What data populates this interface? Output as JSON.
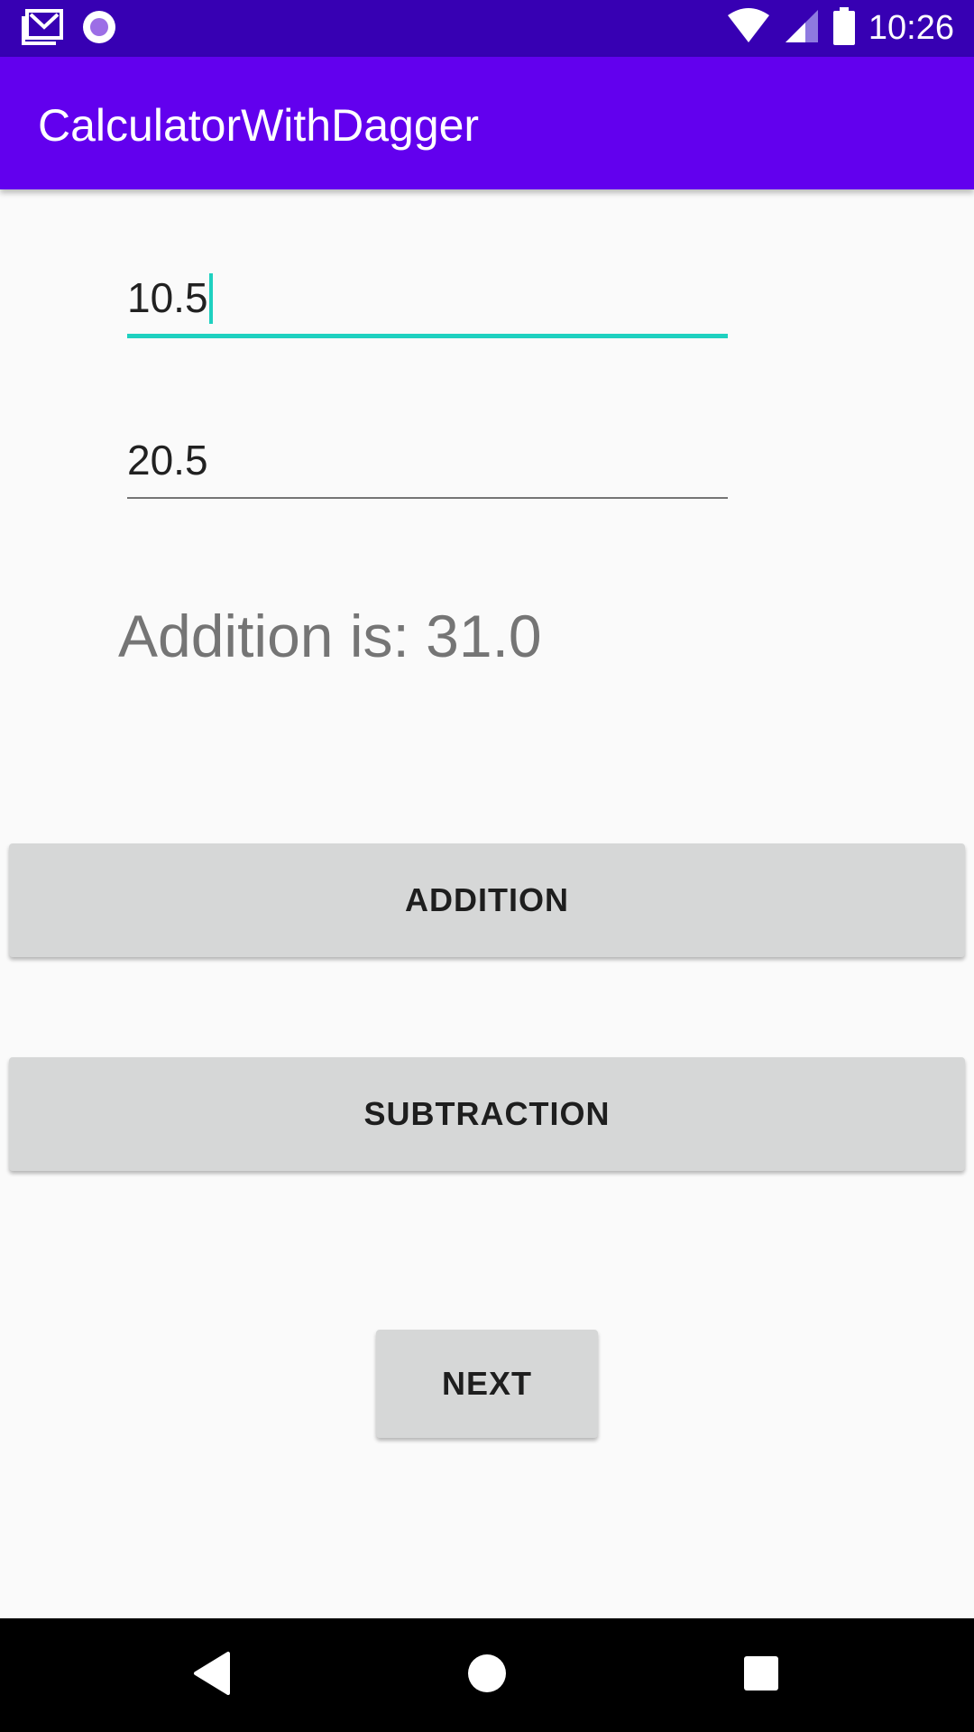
{
  "status_bar": {
    "time": "10:26",
    "left_icons": [
      "gmail-icon",
      "record-icon"
    ],
    "right_icons": [
      "wifi-icon",
      "cell-signal-icon",
      "battery-icon"
    ],
    "background": "#3700b3"
  },
  "app_bar": {
    "title": "CalculatorWithDagger",
    "background": "#6200ee"
  },
  "form": {
    "first_number": "10.5",
    "second_number": "20.5",
    "focus_accent": "#1fd1c0"
  },
  "result": {
    "text": "Addition is: 31.0"
  },
  "buttons": {
    "addition_label": "ADDITION",
    "subtraction_label": "SUBTRACTION",
    "next_label": "NEXT"
  },
  "nav_bar": {
    "icons": [
      "back-icon",
      "home-icon",
      "recent-apps-icon"
    ]
  }
}
